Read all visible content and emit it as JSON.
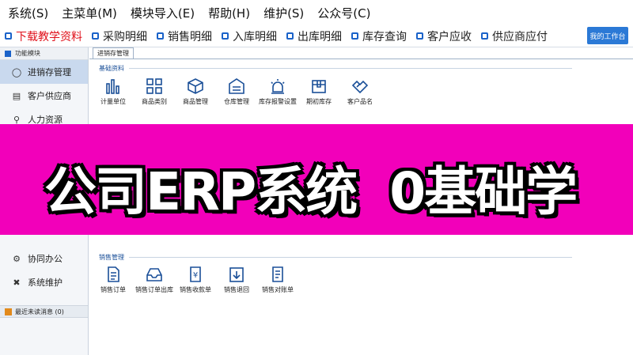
{
  "menubar": {
    "items": [
      "系统(S)",
      "主菜单(M)",
      "模块导入(E)",
      "帮助(H)",
      "维护(S)",
      "公众号(C)"
    ]
  },
  "quickbar": {
    "links": [
      "下载教学资料",
      "采购明细",
      "销售明细",
      "入库明细",
      "出库明细",
      "库存查询",
      "客户应收",
      "供应商应付"
    ],
    "workbench": "我的工作台"
  },
  "sidebar": {
    "header": "功能模块",
    "items": [
      "进销存管理",
      "客户供应商",
      "人力资源",
      "协同办公",
      "系统维护"
    ],
    "bottom": "最近未读消息 (0)"
  },
  "main": {
    "tab": "进销存管理",
    "basic_group": "基础资料",
    "basic_tools": [
      "计量单位",
      "商品类别",
      "商品管理",
      "仓库管理",
      "库存报警设置",
      "期初库存",
      "客户品名"
    ],
    "sales_group": "销售管理",
    "sales_tools": [
      "销售订单",
      "销售订单出库",
      "销售收款单",
      "销售退回",
      "销售对账单"
    ]
  },
  "banner": {
    "text": "公司ERP系统  0基础学"
  },
  "colors": {
    "accent": "#1a62c9",
    "banner": "#f200ba",
    "link_red": "#e0101a"
  }
}
